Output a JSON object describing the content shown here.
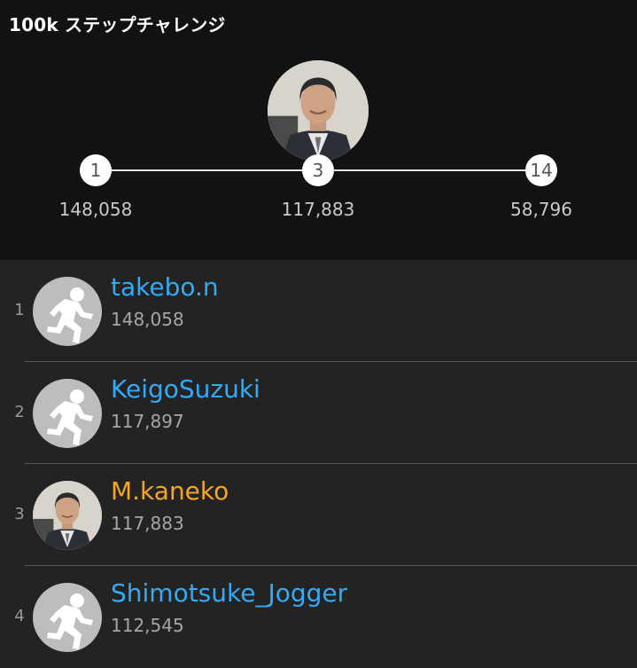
{
  "header": {
    "title": "100k ステップチャレンジ",
    "markers": [
      {
        "rank": "1",
        "steps": "148,058"
      },
      {
        "rank": "3",
        "steps": "117,883"
      },
      {
        "rank": "14",
        "steps": "58,796"
      }
    ],
    "current_avatar_icon": "user-photo"
  },
  "leaderboard": [
    {
      "rank": "1",
      "name": "takebo.n",
      "steps": "148,058",
      "avatar": "runner-icon",
      "name_color": "#33aaf5"
    },
    {
      "rank": "2",
      "name": "KeigoSuzuki",
      "steps": "117,897",
      "avatar": "runner-icon",
      "name_color": "#33aaf5"
    },
    {
      "rank": "3",
      "name": "M.kaneko",
      "steps": "117,883",
      "avatar": "user-photo",
      "name_color": "#f5a623"
    },
    {
      "rank": "4",
      "name": "Shimotsuke_Jogger",
      "steps": "112,545",
      "avatar": "runner-icon",
      "name_color": "#33aaf5"
    }
  ],
  "colors": {
    "header_bg": "#121212",
    "list_bg": "#232323",
    "link_blue": "#33aaf5",
    "self_orange": "#f5a623"
  }
}
